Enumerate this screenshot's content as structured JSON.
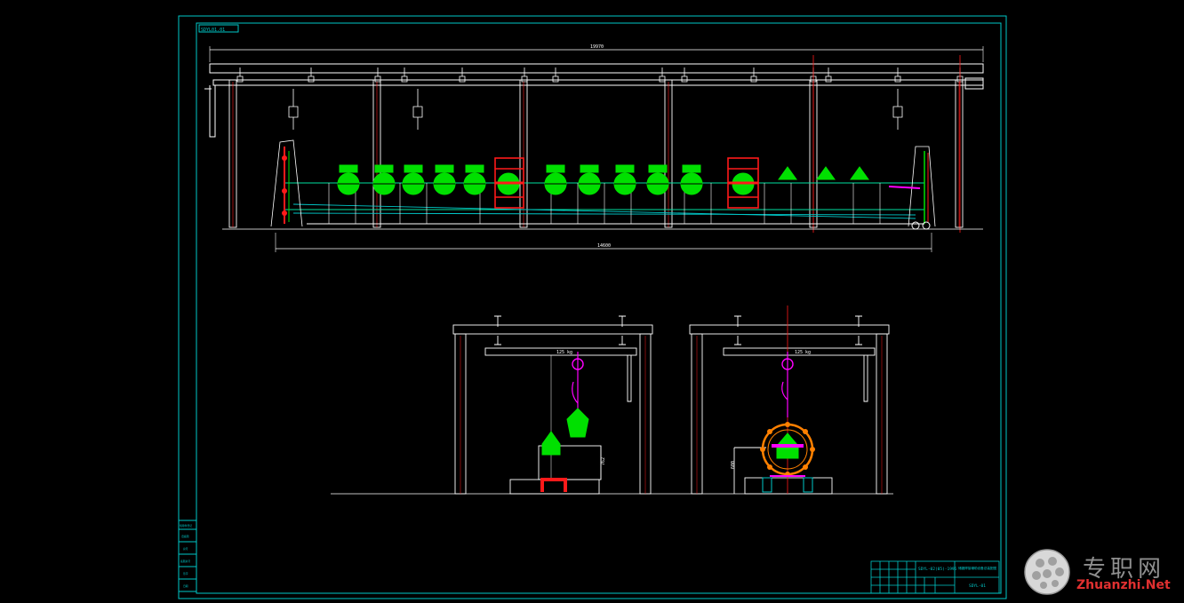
{
  "drawing": {
    "code_box": "SDYL01.01",
    "overall_length": "19970",
    "rail_length": "14600",
    "load_left": "125 kg",
    "load_right": "125 kg",
    "height_left": "762",
    "height_right": "600"
  },
  "title_block": {
    "assembly_title": "SDYL-02(05)-1995",
    "drawing_name": "储罐焊接辅助设备总装配图",
    "drawing_number": "SDYL-01"
  },
  "left_table": {
    "rows": [
      "借用件登记",
      "旧底图",
      "总号",
      "底图总号",
      "签字",
      "日期"
    ]
  },
  "watermark": {
    "cn": "专职网",
    "en": "Zhuanzhi.Net"
  },
  "colors": {
    "frame": "#00c8c8",
    "line": "#ffffff",
    "accent_green": "#00e000",
    "accent_red": "#ff1a1a",
    "accent_magenta": "#ff00ff"
  }
}
